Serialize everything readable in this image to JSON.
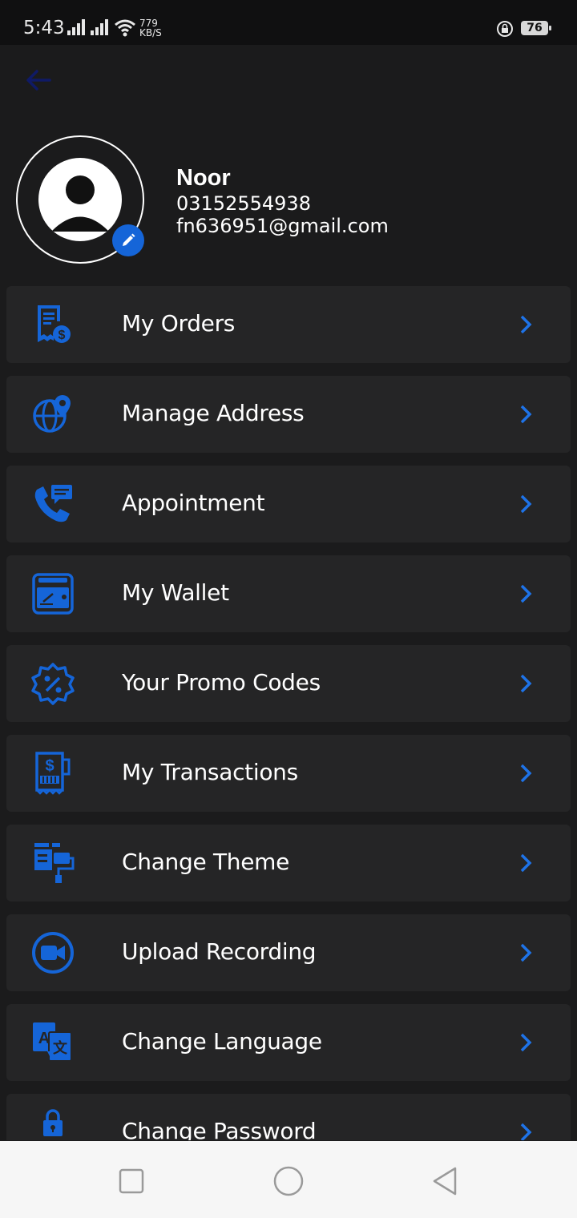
{
  "status_bar": {
    "time": "5:43",
    "speed_value": "779",
    "speed_unit": "KB/S",
    "battery": "76",
    "icons": [
      "signal-icon",
      "signal-icon",
      "wifi-icon",
      "rotation-lock-icon",
      "battery-icon"
    ]
  },
  "colors": {
    "accent": "#1565d8",
    "background": "#1b1b1c",
    "card": "#252526",
    "back_arrow": "#0f1a66"
  },
  "profile": {
    "name": "Noor",
    "phone": "03152554938",
    "email": "fn636951@gmail.com"
  },
  "menu": [
    {
      "label": "My Orders",
      "icon": "receipt-dollar-icon"
    },
    {
      "label": "Manage Address",
      "icon": "globe-location-icon"
    },
    {
      "label": "Appointment",
      "icon": "phone-message-icon"
    },
    {
      "label": "My Wallet",
      "icon": "wallet-icon"
    },
    {
      "label": "Your Promo Codes",
      "icon": "promo-badge-icon"
    },
    {
      "label": "My Transactions",
      "icon": "transaction-receipt-icon"
    },
    {
      "label": "Change Theme",
      "icon": "paint-roller-icon"
    },
    {
      "label": "Upload Recording",
      "icon": "video-camera-icon"
    },
    {
      "label": "Change Language",
      "icon": "translate-icon"
    },
    {
      "label": "Change Password",
      "icon": "lock-icon"
    }
  ],
  "nav_bar": [
    "recent-apps-icon",
    "home-icon",
    "back-icon"
  ]
}
